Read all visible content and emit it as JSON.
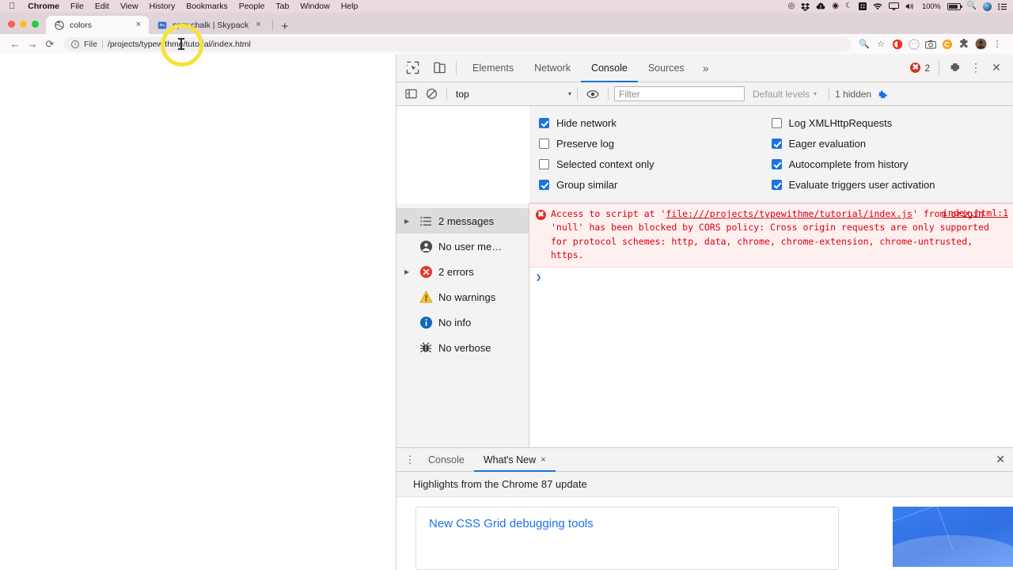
{
  "os_menubar": {
    "apple_icon": "apple-logo",
    "items": [
      "Chrome",
      "File",
      "Edit",
      "View",
      "History",
      "Bookmarks",
      "People",
      "Tab",
      "Window",
      "Help"
    ],
    "status_icons": [
      "record-dot-icon",
      "dropbox-icon",
      "cloud-alert-icon",
      "spiral-icon",
      "moon-icon",
      "grid-icon",
      "wifi-icon",
      "airplay-icon",
      "volume-icon"
    ],
    "battery_percent": "100%",
    "right_icons": [
      "search-icon",
      "account-avatar-icon",
      "control-center-icon"
    ]
  },
  "browser": {
    "tabs": [
      {
        "title": "colors",
        "favicon": "globe-favicon",
        "active": true,
        "close_label": "×"
      },
      {
        "title": "npm:chalk | Skypack",
        "favicon": "skypack-favicon",
        "active": false,
        "close_label": "×"
      }
    ],
    "new_tab_label": "+",
    "nav": {
      "back_label": "←",
      "forward_label": "→",
      "reload_label": "⟳",
      "info_label": "i",
      "scheme_label": "File",
      "url": "/projects/typewithme/tutorial/index.html"
    },
    "toolbar_icons": [
      "zoom-icon",
      "bookmark-star-icon",
      "extension-red-icon",
      "extension-gray-icon",
      "camera-icon",
      "extension-orange-icon",
      "puzzle-extensions-icon",
      "profile-avatar-icon",
      "chrome-menu-icon"
    ]
  },
  "devtools": {
    "header": {
      "inspect_icon": "inspect-element-icon",
      "device_icon": "device-toolbar-icon",
      "tabs": [
        {
          "label": "Elements",
          "active": false
        },
        {
          "label": "Network",
          "active": false
        },
        {
          "label": "Console",
          "active": true
        },
        {
          "label": "Sources",
          "active": false
        }
      ],
      "more_tabs_label": "»",
      "error_count": "2",
      "settings_icon": "gear-icon",
      "more_icon": "kebab-menu-icon",
      "close_icon": "close-icon"
    },
    "filterbar": {
      "sidebar_toggle_icon": "console-sidebar-toggle-icon",
      "clear_icon": "clear-console-icon",
      "context": "top",
      "context_caret": "▾",
      "live_expression_icon": "eye-icon",
      "filter_placeholder": "Filter",
      "filter_value": "",
      "levels_label": "Default levels",
      "levels_caret": "▾",
      "hidden_label": "1 hidden",
      "settings_icon": "gear-icon-active"
    },
    "settings_panel": {
      "left_column": [
        {
          "label": "Hide network",
          "checked": true
        },
        {
          "label": "Preserve log",
          "checked": false
        },
        {
          "label": "Selected context only",
          "checked": false
        },
        {
          "label": "Group similar",
          "checked": true
        }
      ],
      "right_column": [
        {
          "label": "Log XMLHttpRequests",
          "checked": false
        },
        {
          "label": "Eager evaluation",
          "checked": true
        },
        {
          "label": "Autocomplete from history",
          "checked": true
        },
        {
          "label": "Evaluate triggers user activation",
          "checked": true
        }
      ]
    },
    "console_sidebar": [
      {
        "label": "2 messages",
        "icon": "list-icon",
        "expandable": true,
        "selected": true
      },
      {
        "label": "No user me…",
        "icon": "user-message-icon",
        "expandable": false,
        "selected": false
      },
      {
        "label": "2 errors",
        "icon": "error-circle-icon",
        "expandable": true,
        "selected": false
      },
      {
        "label": "No warnings",
        "icon": "warning-triangle-icon",
        "expandable": false,
        "selected": false
      },
      {
        "label": "No info",
        "icon": "info-circle-icon",
        "expandable": false,
        "selected": false
      },
      {
        "label": "No verbose",
        "icon": "bug-icon",
        "expandable": false,
        "selected": false
      }
    ],
    "console_message": {
      "icon": "error-circle-icon",
      "text_part1": "Access to script at '",
      "link": "file:///projects/typewithme/tutorial/index.js",
      "text_part2": "' from origin 'null' has been blocked by CORS policy: Cross origin requests are only supported for protocol schemes: http, data, chrome, chrome-extension, chrome-untrusted, https.",
      "source": "index.html:1"
    },
    "prompt_caret": "❯"
  },
  "drawer": {
    "menu_icon": "kebab-menu-icon",
    "tabs": [
      {
        "label": "Console",
        "active": false,
        "closable": false
      },
      {
        "label": "What's New",
        "active": true,
        "closable": true,
        "close_label": "×"
      }
    ],
    "close_label": "✕",
    "subtitle": "Highlights from the Chrome 87 update",
    "cards": [
      {
        "title": "New CSS Grid debugging tools",
        "thumbnail": "css-grid-thumbnail"
      }
    ]
  },
  "colors": {
    "accent_blue": "#1a73e8",
    "error_red": "#d93025",
    "error_text": "#d8000c",
    "error_bg": "#fff0f0",
    "devtools_chrome": "#f3f3f3",
    "cursor_highlight": "#f7e23d"
  }
}
